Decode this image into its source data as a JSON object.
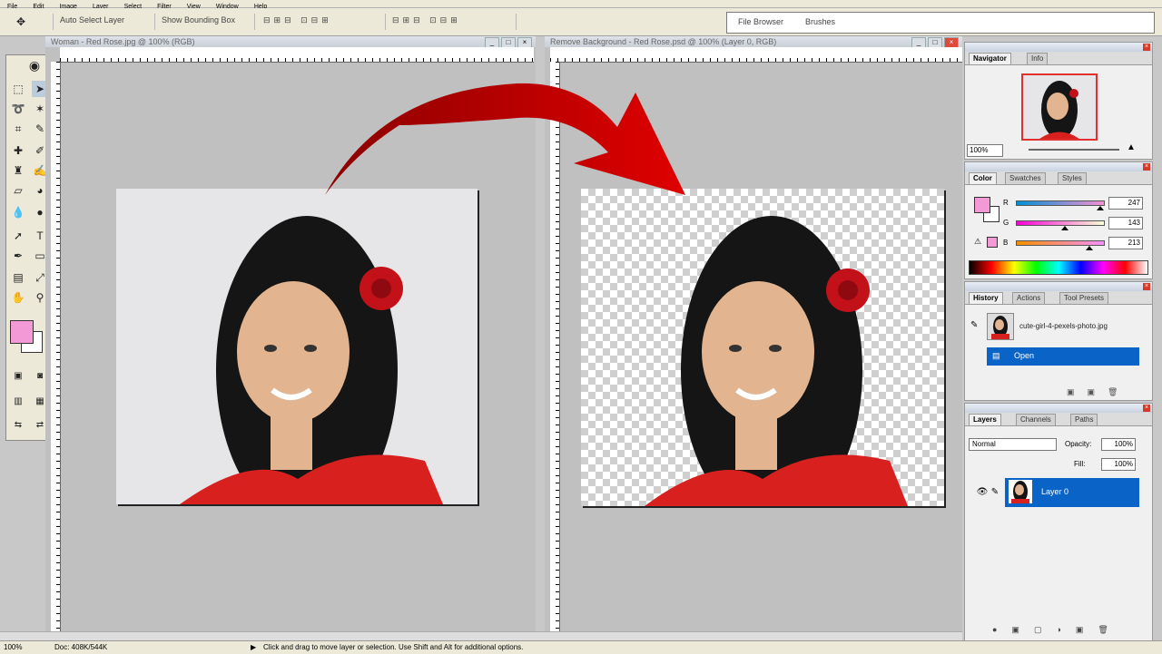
{
  "menu": [
    "File",
    "Edit",
    "Image",
    "Layer",
    "Select",
    "Filter",
    "View",
    "Window",
    "Help"
  ],
  "options": {
    "seg1": "Auto Select Layer",
    "seg2": "Show Bounding Box",
    "palette_tabs": [
      "File Browser",
      "Brushes"
    ]
  },
  "left_doc": {
    "title": "Woman - Red Rose.jpg @ 100% (RGB)"
  },
  "right_doc": {
    "title": "Remove Background - Red Rose.psd @ 100% (Layer 0, RGB)"
  },
  "navigator": {
    "tabs": [
      "Navigator",
      "Info"
    ],
    "zoom": "100%"
  },
  "color": {
    "tabs": [
      "Color",
      "Swatches",
      "Styles"
    ],
    "channels": [
      {
        "label": "R",
        "value": "247",
        "pos": 0.97
      },
      {
        "label": "G",
        "value": "143",
        "pos": 0.56
      },
      {
        "label": "B",
        "value": "213",
        "pos": 0.84
      }
    ],
    "foreground": "#f39ad6",
    "background": "#ffffff"
  },
  "history": {
    "tabs": [
      "History",
      "Actions",
      "Tool Presets"
    ],
    "snapshot": "cute-girl-4-pexels-photo.jpg",
    "items": [
      "Open"
    ]
  },
  "layers": {
    "tabs": [
      "Layers",
      "Channels",
      "Paths"
    ],
    "blend": "Normal",
    "opacity_label": "Opacity:",
    "opacity": "100%",
    "fill_label": "Fill:",
    "fill": "100%",
    "items": [
      "Layer 0"
    ]
  },
  "status": {
    "zoom": "100%",
    "doc": "Doc: 408K/544K",
    "hint": "Click and drag to move layer or selection. Use Shift and Alt for additional options."
  },
  "colors": {
    "accent": "#0a64c8",
    "arrow": "#d40000",
    "dress": "#d8201e"
  }
}
